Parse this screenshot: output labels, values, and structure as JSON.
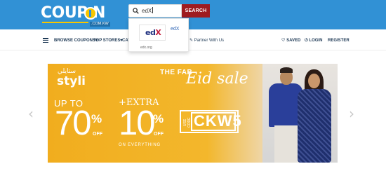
{
  "brand": {
    "logo_text": "COUP  N",
    "domain": ".COM.KW"
  },
  "search": {
    "value": "edX",
    "button_label": "SEARCH"
  },
  "search_suggestions": [
    {
      "name": "edX",
      "logo_text_left": "ed",
      "logo_text_right": "X",
      "url": "edx.org"
    }
  ],
  "nav": {
    "items": [
      {
        "label": "BROWSE COUPONS",
        "has_dropdown": true
      },
      {
        "label": "TOP STORES",
        "has_dropdown": true
      },
      {
        "label": "CAT"
      },
      {
        "label": "Partner With Us"
      }
    ],
    "saved": "SAVED",
    "login": "LOGIN",
    "register": "REGISTER"
  },
  "banner": {
    "brand_arabic": "ستايلي",
    "brand": "styli",
    "headline_small": "THE FAB",
    "headline_script": "Eid sale",
    "discount_prefix": "UP TO",
    "discount_value": "70",
    "discount_symbol": "%",
    "discount_suffix": "OFF",
    "extra_prefix": "+EXTRA",
    "extra_value": "10",
    "extra_symbol": "%",
    "extra_suffix": "OFF",
    "extra_note": "ON EVERYTHING",
    "code_label": "USE CODE",
    "code": "CKW5"
  },
  "carousel": {
    "prev_icon": "‹",
    "next_icon": "›"
  },
  "colors": {
    "header_blue": "#3191d5",
    "search_red": "#9e1b1f",
    "banner_orange": "#f1ad1e",
    "nav_text": "#1f3a56"
  }
}
